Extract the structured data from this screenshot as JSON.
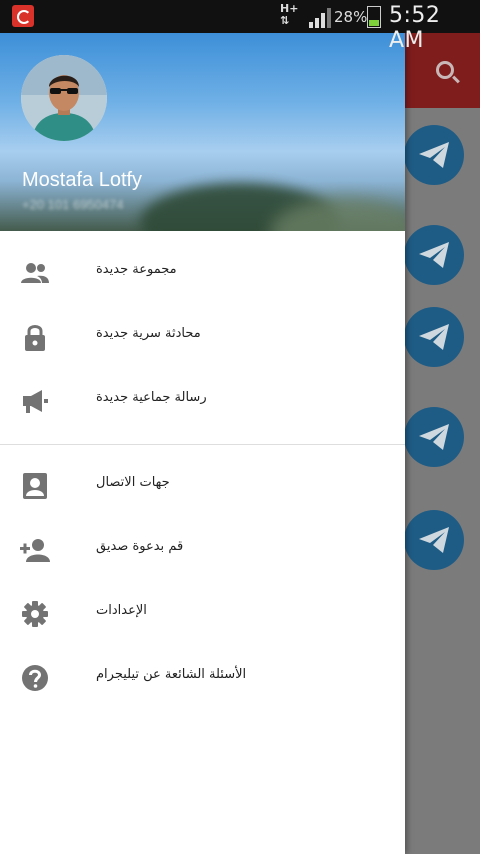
{
  "status_bar": {
    "network": "H+",
    "battery_percent": "28%",
    "battery_level": 0.28,
    "time": "5:52 AM"
  },
  "background_app": {
    "toolbar_color": "#7f1d1d",
    "search_icon": "search-icon",
    "chat_icon": "paper-plane-icon",
    "chat_avatar_count": 5
  },
  "drawer": {
    "profile": {
      "name": "Mostafa Lotfy",
      "phone": "+20 101 6950474"
    },
    "menu_groups": [
      [
        {
          "icon": "group-icon",
          "label": "مجموعة جديدة"
        },
        {
          "icon": "lock-icon",
          "label": "محادثة سرية جديدة"
        },
        {
          "icon": "megaphone-icon",
          "label": "رسالة جماعية جديدة"
        }
      ],
      [
        {
          "icon": "contacts-icon",
          "label": "جهات الاتصال"
        },
        {
          "icon": "add-person-icon",
          "label": "قم بدعوة صديق"
        },
        {
          "icon": "settings-icon",
          "label": "الإعدادات"
        },
        {
          "icon": "help-icon",
          "label": "الأسئلة الشائعة عن تيليجرام"
        }
      ]
    ],
    "icon_color": "#737373"
  }
}
